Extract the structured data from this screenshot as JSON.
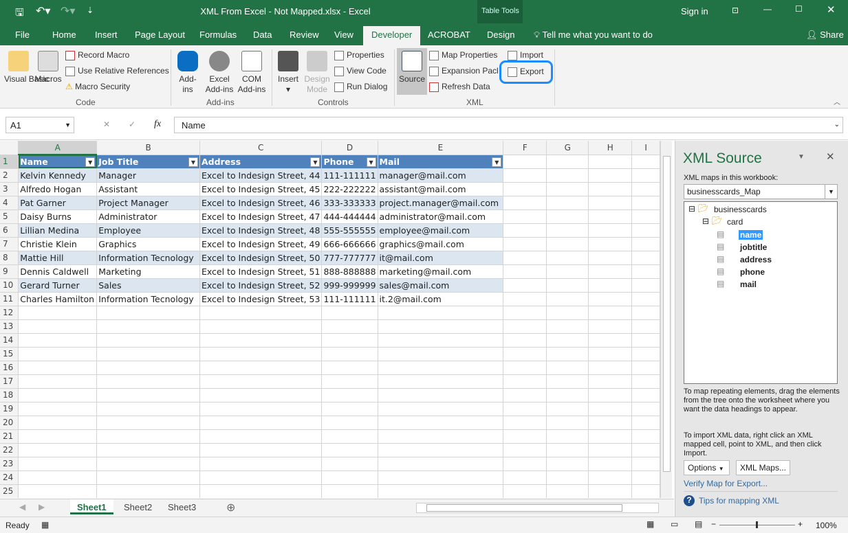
{
  "window": {
    "title": "XML From Excel - Not Mapped.xlsx  -  Excel",
    "context_tab_group": "Table Tools",
    "sign_in": "Sign in",
    "share": "Share"
  },
  "tabs": [
    "File",
    "Home",
    "Insert",
    "Page Layout",
    "Formulas",
    "Data",
    "Review",
    "View",
    "Developer",
    "ACROBAT",
    "Design"
  ],
  "active_tab": "Developer",
  "tell_me": "Tell me what you want to do",
  "ribbon": {
    "code": {
      "label": "Code",
      "visual_basic": "Visual Basic",
      "macros": "Macros",
      "record_macro": "Record Macro",
      "relative_refs": "Use Relative References",
      "macro_security": "Macro Security"
    },
    "addins": {
      "label": "Add-ins",
      "addins": "Add-ins",
      "excel_addins": "Excel Add-ins",
      "com_addins": "COM Add-ins"
    },
    "controls": {
      "label": "Controls",
      "insert": "Insert",
      "design_mode": "Design Mode",
      "properties": "Properties",
      "view_code": "View Code",
      "run_dialog": "Run Dialog"
    },
    "xml": {
      "label": "XML",
      "source": "Source",
      "map_properties": "Map Properties",
      "expansion_packs": "Expansion Pack",
      "refresh_data": "Refresh Data",
      "import": "Import",
      "export": "Export"
    }
  },
  "formula_bar": {
    "name_box": "A1",
    "fx": "fx",
    "value": "Name"
  },
  "columns": [
    "A",
    "B",
    "C",
    "D",
    "E",
    "F",
    "G",
    "H",
    "I"
  ],
  "table": {
    "headers": [
      "Name",
      "Job Title",
      "Address",
      "Phone",
      "Mail"
    ],
    "rows": [
      [
        "Kelvin Kennedy",
        "Manager",
        "Excel to Indesign Street, 44",
        "111-111111",
        "manager@mail.com"
      ],
      [
        "Alfredo Hogan",
        "Assistant",
        "Excel to Indesign Street, 45",
        "222-222222",
        "assistant@mail.com"
      ],
      [
        "Pat Garner",
        "Project Manager",
        "Excel to Indesign Street, 46",
        "333-333333",
        "project.manager@mail.com"
      ],
      [
        "Daisy Burns",
        "Administrator",
        "Excel to Indesign Street, 47",
        "444-444444",
        "administrator@mail.com"
      ],
      [
        "Lillian Medina",
        "Employee",
        "Excel to Indesign Street, 48",
        "555-555555",
        "employee@mail.com"
      ],
      [
        "Christie Klein",
        "Graphics",
        "Excel to Indesign Street, 49",
        "666-666666",
        "graphics@mail.com"
      ],
      [
        "Mattie Hill",
        "Information Tecnology",
        "Excel to Indesign Street, 50",
        "777-777777",
        "it@mail.com"
      ],
      [
        "Dennis Caldwell",
        "Marketing",
        "Excel to Indesign Street, 51",
        "888-888888",
        "marketing@mail.com"
      ],
      [
        "Gerard Turner",
        "Sales",
        "Excel to Indesign Street, 52",
        "999-999999",
        "sales@mail.com"
      ],
      [
        "Charles Hamilton",
        "Information Tecnology",
        "Excel to Indesign Street, 53",
        "111-111111",
        "it.2@mail.com"
      ]
    ]
  },
  "row_count": 25,
  "sheets": [
    "Sheet1",
    "Sheet2",
    "Sheet3"
  ],
  "active_sheet": "Sheet1",
  "status": {
    "ready": "Ready",
    "zoom": "100%"
  },
  "xml_source": {
    "title": "XML Source",
    "maps_label": "XML maps in this workbook:",
    "selected_map": "businesscards_Map",
    "root": "businesscards",
    "repeating": "card",
    "elements": [
      "name",
      "jobtitle",
      "address",
      "phone",
      "mail"
    ],
    "selected_element": "name",
    "help1": "To map repeating elements, drag the elements from the tree onto the worksheet where you want the data headings to appear.",
    "help2": "To import XML data, right click an XML mapped cell, point to XML, and then click Import.",
    "options": "Options",
    "xml_maps": "XML Maps...",
    "verify": "Verify Map for Export...",
    "tips": "Tips for mapping XML"
  },
  "colors": {
    "excel_green": "#217346",
    "table_header": "#4f81bd",
    "table_band": "#dce6f1",
    "highlight_circle": "#1a8cff"
  }
}
